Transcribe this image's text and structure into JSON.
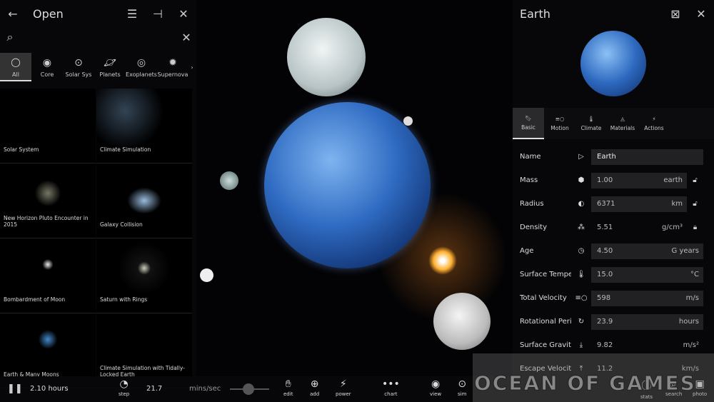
{
  "left_panel": {
    "title": "Open",
    "categories": [
      {
        "label": "All",
        "icon": "ring-icon"
      },
      {
        "label": "Core",
        "icon": "core-icon"
      },
      {
        "label": "Solar Sys",
        "icon": "solar-system-icon"
      },
      {
        "label": "Planets",
        "icon": "planet-icon"
      },
      {
        "label": "Exoplanets",
        "icon": "exoplanet-icon"
      },
      {
        "label": "Supernova",
        "icon": "supernova-icon"
      }
    ],
    "scenarios": [
      "Solar System",
      "Climate Simulation",
      "New Horizon Pluto Encounter in 2015",
      "Galaxy Collision",
      "Bombardment of Moon",
      "Saturn with Rings",
      "Earth & Many Moons",
      "Climate Simulation with Tidally-Locked Earth"
    ]
  },
  "right_panel": {
    "title": "Earth",
    "tabs": [
      {
        "label": "Basic",
        "icon": "bookmark-icon"
      },
      {
        "label": "Motion",
        "icon": "motion-icon"
      },
      {
        "label": "Climate",
        "icon": "thermometer-icon"
      },
      {
        "label": "Materials",
        "icon": "materials-icon"
      },
      {
        "label": "Actions",
        "icon": "lightning-icon"
      }
    ],
    "properties": [
      {
        "name": "Name",
        "value": "Earth",
        "unit": ""
      },
      {
        "name": "Mass",
        "value": "1.00",
        "unit": "earth",
        "lock": "unlocked"
      },
      {
        "name": "Radius",
        "value": "6371",
        "unit": "km",
        "lock": "unlocked"
      },
      {
        "name": "Density",
        "value": "5.51",
        "unit": "g/cm³",
        "lock": "locked"
      },
      {
        "name": "Age",
        "value": "4.50",
        "unit": "G years"
      },
      {
        "name": "Surface Temperatu...",
        "value": "15.0",
        "unit": "°C"
      },
      {
        "name": "Total Velocity",
        "value": "598",
        "unit": "m/s"
      },
      {
        "name": "Rotational Period",
        "value": "23.9",
        "unit": "hours"
      },
      {
        "name": "Surface Gravity",
        "value": "9.82",
        "unit": "m/s²"
      },
      {
        "name": "Escape Velocity",
        "value": "11.2",
        "unit": "km/s"
      }
    ]
  },
  "bottom_bar": {
    "time": "2.10 hours",
    "step_label": "step",
    "step_value": "21.7",
    "step_unit": "mins/sec",
    "slider_value": 0.5,
    "tools": [
      "edit",
      "add",
      "power",
      "chart",
      "view",
      "sim",
      "stats",
      "search",
      "photo"
    ]
  },
  "watermark": "OCEAN OF GAMES"
}
